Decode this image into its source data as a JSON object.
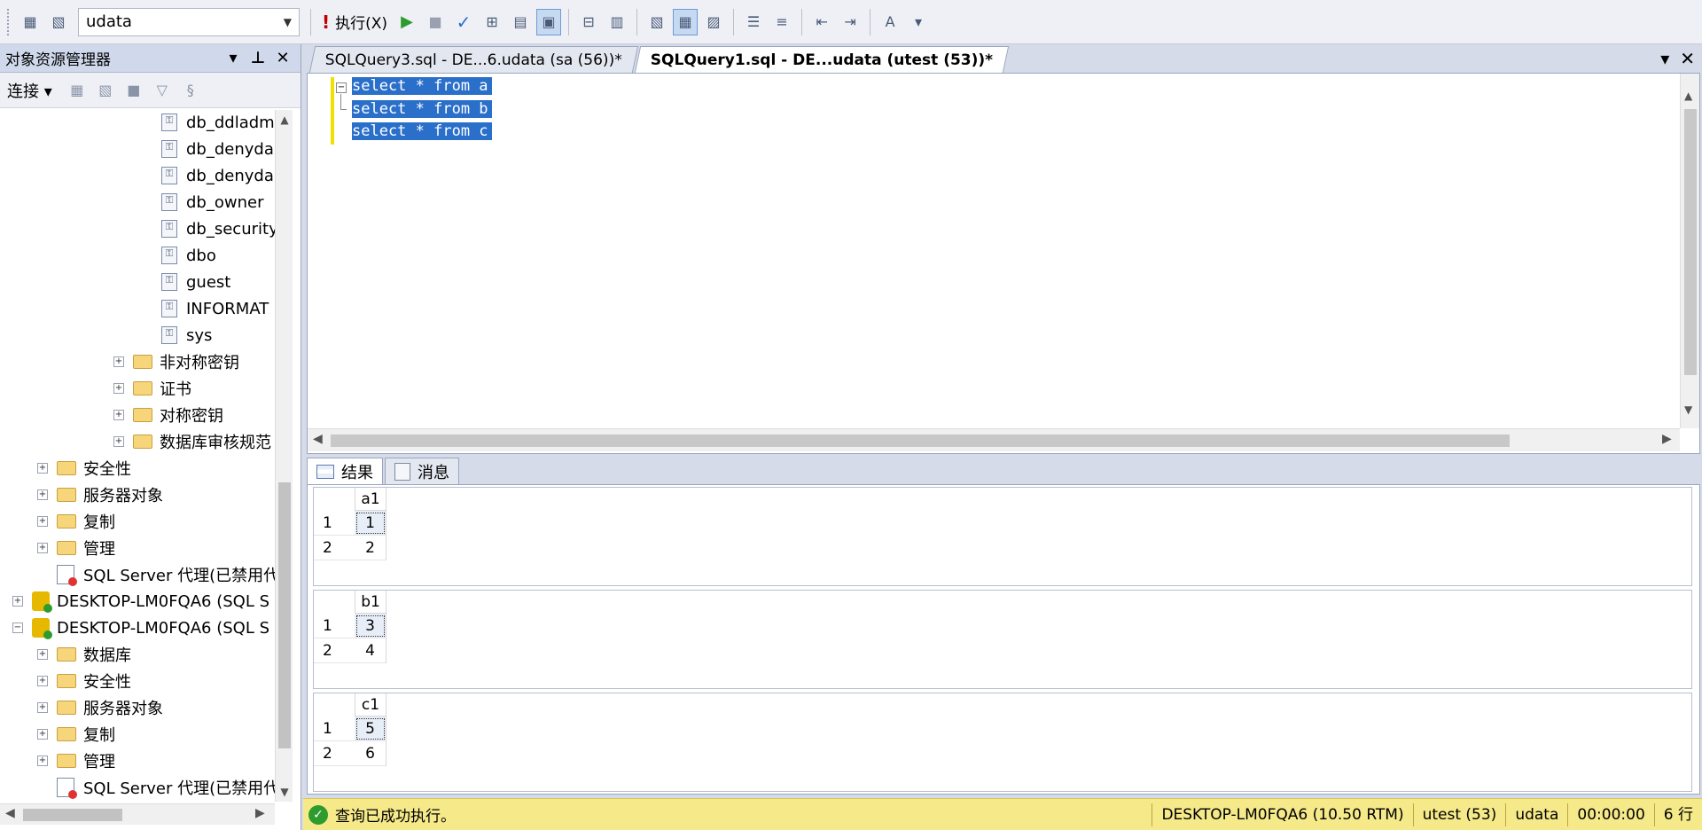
{
  "toolbar": {
    "database": "udata",
    "execute_label": "执行(X)"
  },
  "object_explorer": {
    "title": "对象资源管理器",
    "connect_label": "连接",
    "nodes": [
      {
        "label": "db_ddladm",
        "kind": "user"
      },
      {
        "label": "db_denyda",
        "kind": "user"
      },
      {
        "label": "db_denyda",
        "kind": "user"
      },
      {
        "label": "db_owner",
        "kind": "user"
      },
      {
        "label": "db_security",
        "kind": "user"
      },
      {
        "label": "dbo",
        "kind": "user"
      },
      {
        "label": "guest",
        "kind": "user"
      },
      {
        "label": "INFORMAT",
        "kind": "user"
      },
      {
        "label": "sys",
        "kind": "user"
      },
      {
        "label": "非对称密钥",
        "kind": "folder"
      },
      {
        "label": "证书",
        "kind": "folder"
      },
      {
        "label": "对称密钥",
        "kind": "folder"
      },
      {
        "label": "数据库审核规范",
        "kind": "folder"
      },
      {
        "label": "安全性",
        "kind": "folder"
      },
      {
        "label": "服务器对象",
        "kind": "folder"
      },
      {
        "label": "复制",
        "kind": "folder"
      },
      {
        "label": "管理",
        "kind": "folder"
      },
      {
        "label": "SQL Server 代理(已禁用代",
        "kind": "agent"
      },
      {
        "label": "DESKTOP-LM0FQA6 (SQL S",
        "kind": "server"
      },
      {
        "label": "DESKTOP-LM0FQA6 (SQL S",
        "kind": "server"
      },
      {
        "label": "数据库",
        "kind": "folder"
      },
      {
        "label": "安全性",
        "kind": "folder"
      },
      {
        "label": "服务器对象",
        "kind": "folder"
      },
      {
        "label": "复制",
        "kind": "folder"
      },
      {
        "label": "管理",
        "kind": "folder"
      },
      {
        "label": "SQL Server 代理(已禁用代",
        "kind": "agent"
      }
    ]
  },
  "tabs": [
    {
      "label": "SQLQuery3.sql - DE...6.udata (sa (56))*",
      "active": false
    },
    {
      "label": "SQLQuery1.sql - DE...udata (utest (53))*",
      "active": true
    }
  ],
  "editor": {
    "lines": [
      "select * from a",
      "select * from b",
      "select * from c"
    ]
  },
  "result_tabs": {
    "results": "结果",
    "messages": "消息"
  },
  "results": [
    {
      "column": "a1",
      "rows": [
        {
          "n": "1",
          "v": "1"
        },
        {
          "n": "2",
          "v": "2"
        }
      ]
    },
    {
      "column": "b1",
      "rows": [
        {
          "n": "1",
          "v": "3"
        },
        {
          "n": "2",
          "v": "4"
        }
      ]
    },
    {
      "column": "c1",
      "rows": [
        {
          "n": "1",
          "v": "5"
        },
        {
          "n": "2",
          "v": "6"
        }
      ]
    }
  ],
  "status": {
    "message": "查询已成功执行。",
    "server": "DESKTOP-LM0FQA6 (10.50 RTM)",
    "user": "utest (53)",
    "database": "udata",
    "time": "00:00:00",
    "rows": "6 行"
  }
}
